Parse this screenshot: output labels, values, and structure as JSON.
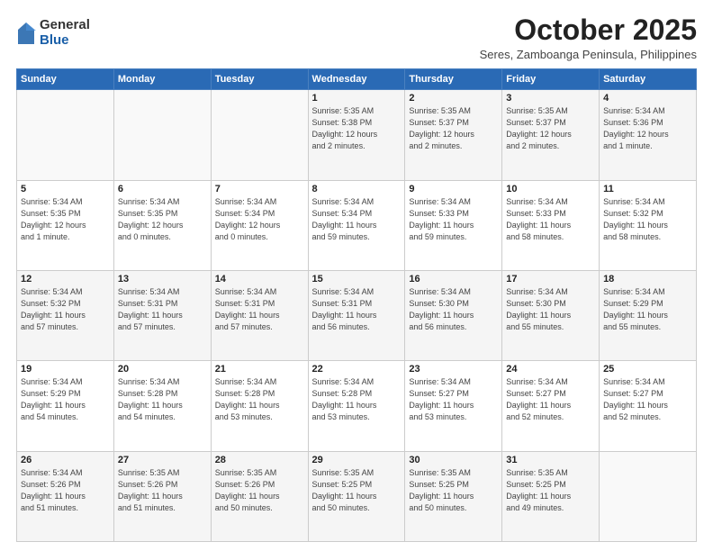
{
  "logo": {
    "general": "General",
    "blue": "Blue"
  },
  "header": {
    "month": "October 2025",
    "location": "Seres, Zamboanga Peninsula, Philippines"
  },
  "weekdays": [
    "Sunday",
    "Monday",
    "Tuesday",
    "Wednesday",
    "Thursday",
    "Friday",
    "Saturday"
  ],
  "weeks": [
    [
      {
        "day": "",
        "info": ""
      },
      {
        "day": "",
        "info": ""
      },
      {
        "day": "",
        "info": ""
      },
      {
        "day": "1",
        "info": "Sunrise: 5:35 AM\nSunset: 5:38 PM\nDaylight: 12 hours\nand 2 minutes."
      },
      {
        "day": "2",
        "info": "Sunrise: 5:35 AM\nSunset: 5:37 PM\nDaylight: 12 hours\nand 2 minutes."
      },
      {
        "day": "3",
        "info": "Sunrise: 5:35 AM\nSunset: 5:37 PM\nDaylight: 12 hours\nand 2 minutes."
      },
      {
        "day": "4",
        "info": "Sunrise: 5:34 AM\nSunset: 5:36 PM\nDaylight: 12 hours\nand 1 minute."
      }
    ],
    [
      {
        "day": "5",
        "info": "Sunrise: 5:34 AM\nSunset: 5:35 PM\nDaylight: 12 hours\nand 1 minute."
      },
      {
        "day": "6",
        "info": "Sunrise: 5:34 AM\nSunset: 5:35 PM\nDaylight: 12 hours\nand 0 minutes."
      },
      {
        "day": "7",
        "info": "Sunrise: 5:34 AM\nSunset: 5:34 PM\nDaylight: 12 hours\nand 0 minutes."
      },
      {
        "day": "8",
        "info": "Sunrise: 5:34 AM\nSunset: 5:34 PM\nDaylight: 11 hours\nand 59 minutes."
      },
      {
        "day": "9",
        "info": "Sunrise: 5:34 AM\nSunset: 5:33 PM\nDaylight: 11 hours\nand 59 minutes."
      },
      {
        "day": "10",
        "info": "Sunrise: 5:34 AM\nSunset: 5:33 PM\nDaylight: 11 hours\nand 58 minutes."
      },
      {
        "day": "11",
        "info": "Sunrise: 5:34 AM\nSunset: 5:32 PM\nDaylight: 11 hours\nand 58 minutes."
      }
    ],
    [
      {
        "day": "12",
        "info": "Sunrise: 5:34 AM\nSunset: 5:32 PM\nDaylight: 11 hours\nand 57 minutes."
      },
      {
        "day": "13",
        "info": "Sunrise: 5:34 AM\nSunset: 5:31 PM\nDaylight: 11 hours\nand 57 minutes."
      },
      {
        "day": "14",
        "info": "Sunrise: 5:34 AM\nSunset: 5:31 PM\nDaylight: 11 hours\nand 57 minutes."
      },
      {
        "day": "15",
        "info": "Sunrise: 5:34 AM\nSunset: 5:31 PM\nDaylight: 11 hours\nand 56 minutes."
      },
      {
        "day": "16",
        "info": "Sunrise: 5:34 AM\nSunset: 5:30 PM\nDaylight: 11 hours\nand 56 minutes."
      },
      {
        "day": "17",
        "info": "Sunrise: 5:34 AM\nSunset: 5:30 PM\nDaylight: 11 hours\nand 55 minutes."
      },
      {
        "day": "18",
        "info": "Sunrise: 5:34 AM\nSunset: 5:29 PM\nDaylight: 11 hours\nand 55 minutes."
      }
    ],
    [
      {
        "day": "19",
        "info": "Sunrise: 5:34 AM\nSunset: 5:29 PM\nDaylight: 11 hours\nand 54 minutes."
      },
      {
        "day": "20",
        "info": "Sunrise: 5:34 AM\nSunset: 5:28 PM\nDaylight: 11 hours\nand 54 minutes."
      },
      {
        "day": "21",
        "info": "Sunrise: 5:34 AM\nSunset: 5:28 PM\nDaylight: 11 hours\nand 53 minutes."
      },
      {
        "day": "22",
        "info": "Sunrise: 5:34 AM\nSunset: 5:28 PM\nDaylight: 11 hours\nand 53 minutes."
      },
      {
        "day": "23",
        "info": "Sunrise: 5:34 AM\nSunset: 5:27 PM\nDaylight: 11 hours\nand 53 minutes."
      },
      {
        "day": "24",
        "info": "Sunrise: 5:34 AM\nSunset: 5:27 PM\nDaylight: 11 hours\nand 52 minutes."
      },
      {
        "day": "25",
        "info": "Sunrise: 5:34 AM\nSunset: 5:27 PM\nDaylight: 11 hours\nand 52 minutes."
      }
    ],
    [
      {
        "day": "26",
        "info": "Sunrise: 5:34 AM\nSunset: 5:26 PM\nDaylight: 11 hours\nand 51 minutes."
      },
      {
        "day": "27",
        "info": "Sunrise: 5:35 AM\nSunset: 5:26 PM\nDaylight: 11 hours\nand 51 minutes."
      },
      {
        "day": "28",
        "info": "Sunrise: 5:35 AM\nSunset: 5:26 PM\nDaylight: 11 hours\nand 50 minutes."
      },
      {
        "day": "29",
        "info": "Sunrise: 5:35 AM\nSunset: 5:25 PM\nDaylight: 11 hours\nand 50 minutes."
      },
      {
        "day": "30",
        "info": "Sunrise: 5:35 AM\nSunset: 5:25 PM\nDaylight: 11 hours\nand 50 minutes."
      },
      {
        "day": "31",
        "info": "Sunrise: 5:35 AM\nSunset: 5:25 PM\nDaylight: 11 hours\nand 49 minutes."
      },
      {
        "day": "",
        "info": ""
      }
    ]
  ]
}
